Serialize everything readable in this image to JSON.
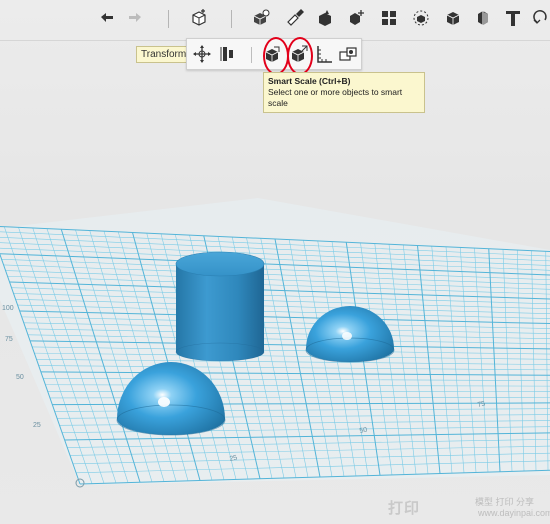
{
  "toolbar": {
    "icons": [
      "undo-icon",
      "redo-icon",
      "primitives-icon",
      "construct-icon",
      "modify-icon",
      "pattern-icon",
      "group-icon",
      "combine-icon",
      "measure-icon",
      "snap-icon",
      "material-icon",
      "text-icon",
      "help-icon"
    ]
  },
  "transform_tooltip": "Transform",
  "transform_bar": {
    "icons": [
      "move-icon",
      "align-icon",
      "scale-icon",
      "smart-scale-icon",
      "ruler-icon",
      "dimension-icon"
    ]
  },
  "smart_scale_tooltip": {
    "title": "Smart Scale (Ctrl+B)",
    "description": "Select one or more objects to smart scale"
  },
  "grid": {
    "left_axis_labels": [
      "100",
      "75",
      "50",
      "25"
    ],
    "bottom_axis_labels": [
      "25",
      "50",
      "75"
    ]
  },
  "colors": {
    "accent": "#2b8fc9",
    "grid": "#7ccce7",
    "highlight": "#e2001a",
    "tooltip_bg": "#fbf7cf"
  },
  "watermark": {
    "text": "打印",
    "subtext": "模型 打印 分享",
    "url": "www.dayinpai.com"
  }
}
